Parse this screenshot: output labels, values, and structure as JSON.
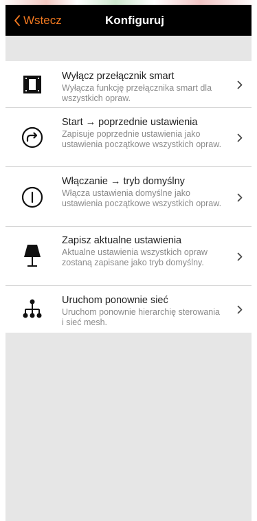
{
  "colors": {
    "accent": "#f47a20",
    "navbar": "#000000",
    "background": "#e6e6e6"
  },
  "nav": {
    "back_label": "Wstecz",
    "title": "Konfiguruj"
  },
  "items": [
    {
      "icon": "switch-square-icon",
      "title": "Wyłącz przełącznik smart",
      "description": "Wyłącza funkcję przełącznika smart dla wszystkich opraw."
    },
    {
      "icon": "redo-arrow-circle-icon",
      "title": "Start → poprzednie ustawienia",
      "description": "Zapisuje poprzednie ustawienia jako ustawienia początkowe wszystkich opraw."
    },
    {
      "icon": "power-circle-icon",
      "title": "Włączanie → tryb domyślny",
      "description": "Włącza ustawienia domyślne jako ustawienia początkowe wszystkich opraw."
    },
    {
      "icon": "lamp-icon",
      "title": "Zapisz aktualne ustawienia",
      "description": "Aktualne ustawienia wszystkich opraw zostaną zapisane jako tryb domyślny."
    },
    {
      "icon": "mesh-network-icon",
      "title": "Uruchom ponownie sieć",
      "description": "Uruchom ponownie hierarchię sterowania i sieć mesh."
    }
  ]
}
